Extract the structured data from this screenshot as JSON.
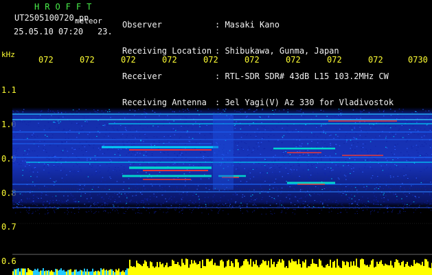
{
  "header": {
    "title": "HROFFT",
    "filename": "UT2505100720.pn",
    "meteor_label": "meteor",
    "datetime": "25.05.10 07:20",
    "count": "23."
  },
  "station": {
    "observer_label": "Observer",
    "observer_value": ": Masaki Kano",
    "location_label": "Receiving Location",
    "location_value": ": Shibukawa, Gunma, Japan",
    "receiver_label": "Receiver",
    "receiver_value": ": RTL-SDR SDR# 43dB L15 103.2MHz CW",
    "antenna_label": "Receiving Antenna",
    "antenna_value": ": 3el Yagi(V) Az 330 for Vladivostok"
  },
  "axes": {
    "unit": "kHz",
    "time_ticks": [
      "072",
      "072",
      "072",
      "072",
      "072",
      "072",
      "072",
      "072",
      "072",
      "0730"
    ],
    "freq_ticks": [
      "1.1",
      "1.0",
      "0.9",
      "0.8",
      "0.7",
      "0.6"
    ]
  },
  "colors": {
    "background": "#000000",
    "header_green": "#49f04a",
    "header_white": "#f2f2f2",
    "axis_yellow": "#ffff33",
    "spectrum_low": "#1a30c0",
    "spectrum_mid": "#00d8e8",
    "spectrum_high": "#ff3030",
    "level_bar": "#ffff00",
    "level_bar_left": "#22c8ff"
  }
}
